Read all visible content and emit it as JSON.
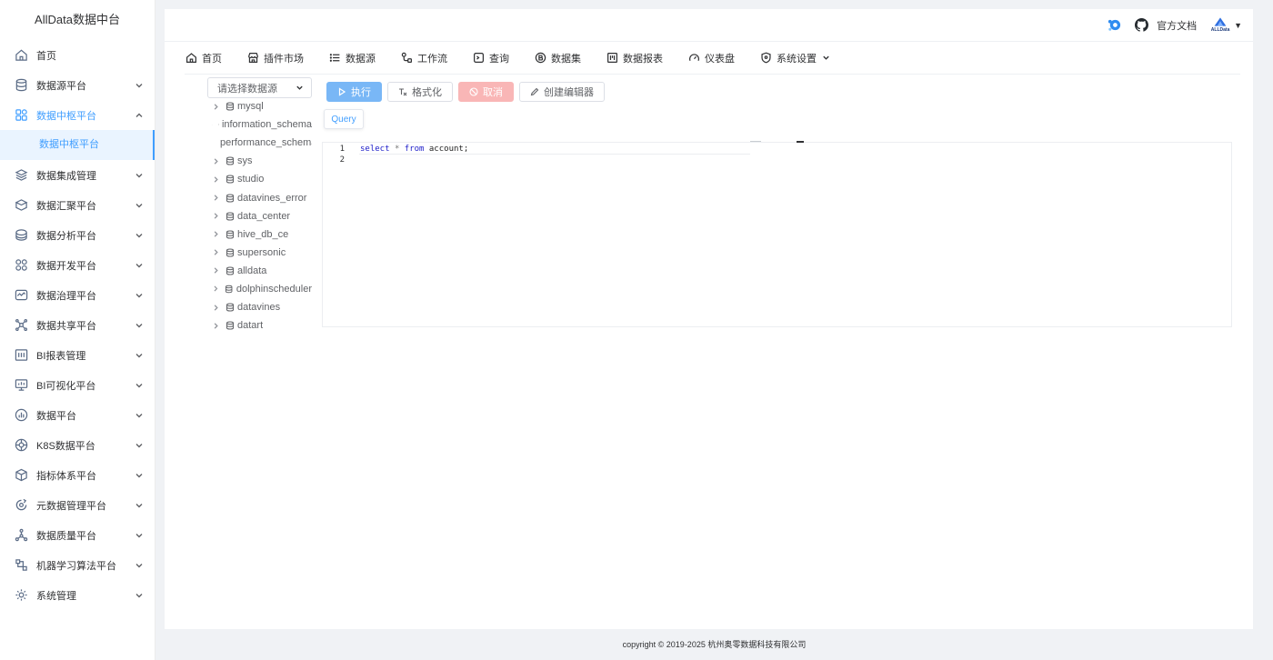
{
  "app": {
    "title": "AllData数据中台"
  },
  "sidebar": {
    "items": [
      {
        "label": "首页",
        "icon": "home-icon",
        "has_children": false
      },
      {
        "label": "数据源平台",
        "icon": "database-icon",
        "has_children": true
      },
      {
        "label": "数据中枢平台",
        "icon": "grid-icon",
        "has_children": true,
        "open": true,
        "children": [
          {
            "label": "数据中枢平台",
            "active": true
          }
        ]
      },
      {
        "label": "数据集成管理",
        "icon": "layers-icon",
        "has_children": true
      },
      {
        "label": "数据汇聚平台",
        "icon": "stack-icon",
        "has_children": true
      },
      {
        "label": "数据分析平台",
        "icon": "analysis-icon",
        "has_children": true
      },
      {
        "label": "数据开发平台",
        "icon": "dev-icon",
        "has_children": true
      },
      {
        "label": "数据治理平台",
        "icon": "governance-icon",
        "has_children": true
      },
      {
        "label": "数据共享平台",
        "icon": "share-icon",
        "has_children": true
      },
      {
        "label": "BI报表管理",
        "icon": "report-icon",
        "has_children": true
      },
      {
        "label": "BI可视化平台",
        "icon": "monitor-icon",
        "has_children": true
      },
      {
        "label": "数据平台",
        "icon": "chart-icon",
        "has_children": true
      },
      {
        "label": "K8S数据平台",
        "icon": "k8s-icon",
        "has_children": true
      },
      {
        "label": "指标体系平台",
        "icon": "cube-icon",
        "has_children": true
      },
      {
        "label": "元数据管理平台",
        "icon": "metadata-icon",
        "has_children": true
      },
      {
        "label": "数据质量平台",
        "icon": "quality-icon",
        "has_children": true
      },
      {
        "label": "机器学习算法平台",
        "icon": "ml-icon",
        "has_children": true
      },
      {
        "label": "系统管理",
        "icon": "settings-icon",
        "has_children": true
      }
    ]
  },
  "header": {
    "docs_label": "官方文档",
    "brand_logo_text": "ALLData"
  },
  "topnav": {
    "items": [
      {
        "label": "首页",
        "icon": "home-icon"
      },
      {
        "label": "插件市场",
        "icon": "store-icon"
      },
      {
        "label": "数据源",
        "icon": "list-icon"
      },
      {
        "label": "工作流",
        "icon": "workflow-icon"
      },
      {
        "label": "查询",
        "icon": "terminal-icon"
      },
      {
        "label": "数据集",
        "icon": "dataset-icon"
      },
      {
        "label": "数据报表",
        "icon": "report-icon"
      },
      {
        "label": "仪表盘",
        "icon": "gauge-icon"
      },
      {
        "label": "系统设置",
        "icon": "shield-icon",
        "dropdown": true
      }
    ]
  },
  "query": {
    "datasource_placeholder": "请选择数据源",
    "databases": [
      "mysql",
      "information_schema",
      "performance_schema",
      "sys",
      "studio",
      "datavines_error",
      "data_center",
      "hive_db_ce",
      "supersonic",
      "alldata",
      "dolphinscheduler",
      "datavines",
      "datart"
    ],
    "toolbar": {
      "run_label": "执行",
      "format_label": "格式化",
      "cancel_label": "取消",
      "create_editor_label": "创建编辑器"
    },
    "tab_label": "Query",
    "editor": {
      "line_numbers": [
        "1",
        "2"
      ],
      "kw_select": "select",
      "op_star": "*",
      "kw_from": "from",
      "ident": "account;"
    }
  },
  "footer": {
    "copyright": "copyright © 2019-2025 杭州奥零数据科技有限公司"
  },
  "colors": {
    "accent": "#409eff",
    "primary_button": "#79b7f6",
    "danger_button": "#f9b6b6"
  }
}
